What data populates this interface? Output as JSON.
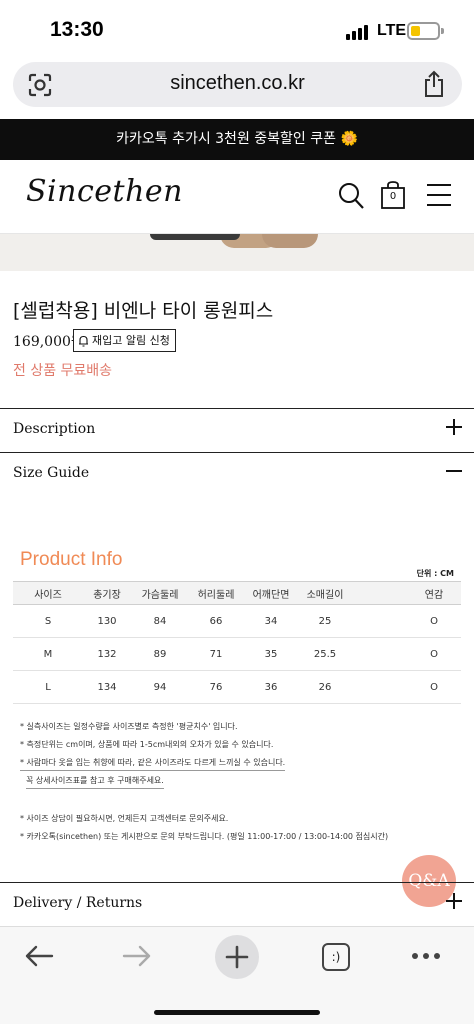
{
  "status_bar": {
    "time": "13:30",
    "network": "LTE"
  },
  "browser": {
    "url": "sincethen.co.kr",
    "icons": {
      "lens": "lens-icon",
      "share": "share-icon",
      "back": "back-arrow-icon",
      "forward": "forward-arrow-icon",
      "new_tab": "plus-icon",
      "tabs": "tabs-icon",
      "more": "more-icon"
    },
    "tabs_label": ":)"
  },
  "promo_banner": {
    "text": "카카오톡 추가시 3천원 중복할인 쿠폰 🌼"
  },
  "site_header": {
    "logo": "Sincethen",
    "cart_count": "0"
  },
  "product": {
    "title": "[셀럽착용] 비엔나 타이 롱원피스",
    "price": "169,000원",
    "restock_label": "재입고 알림 신청",
    "free_shipping": "전 상품 무료배송"
  },
  "accordions": {
    "description": "Description",
    "size_guide": "Size Guide",
    "delivery": "Delivery / Returns"
  },
  "size_guide": {
    "title": "Product Info",
    "unit": "단위 : CM",
    "headers": [
      "사이즈",
      "총기장",
      "가슴둘레",
      "허리둘레",
      "어깨단면",
      "소매길이",
      "",
      "연감"
    ],
    "rows": [
      [
        "S",
        "130",
        "84",
        "66",
        "34",
        "25",
        "",
        "O"
      ],
      [
        "M",
        "132",
        "89",
        "71",
        "35",
        "25.5",
        "",
        "O"
      ],
      [
        "L",
        "134",
        "94",
        "76",
        "36",
        "26",
        "",
        "O"
      ]
    ],
    "notes": [
      "* 실측사이즈는 일정수량을 사이즈별로 측정한 '평균치수' 입니다.",
      "* 측정단위는 cm이며, 상품에 따라 1-5cm내외의 오차가 있을 수 있습니다.",
      "* 사람마다 옷을 입는 취향에 따라, 같은 사이즈라도 다르게 느끼실 수 있습니다.",
      "꼭 상세사이즈표를 참고 후 구매해주세요."
    ],
    "notes2": [
      "* 사이즈 상담이 필요하시면, 언제든지 고객센터로 문의주세요.",
      "* 카카오톡(sincethen) 또는 게시판으로 문의 부탁드립니다. (평일 11:00-17:00 / 13:00-14:00 점심시간)"
    ]
  },
  "qna_button": {
    "label": "Q&A"
  }
}
